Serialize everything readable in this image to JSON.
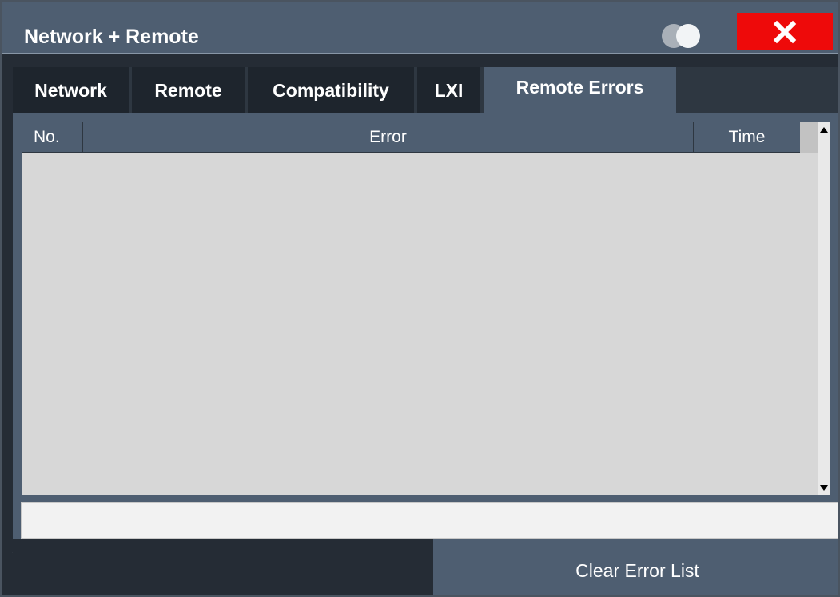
{
  "window": {
    "title": "Network + Remote",
    "toggle_icon": "toggle-icon",
    "close_icon": "close-icon",
    "close_color": "#ee0a0a"
  },
  "tabs": [
    {
      "label": "Network",
      "active": false
    },
    {
      "label": "Remote",
      "active": false
    },
    {
      "label": "Compatibility",
      "active": false
    },
    {
      "label": "LXI",
      "active": false
    },
    {
      "label": "Remote Errors",
      "active": true
    }
  ],
  "error_table": {
    "columns": [
      "No.",
      "Error",
      "Time"
    ],
    "rows": []
  },
  "status_field": {
    "value": ""
  },
  "actions": {
    "clear_label": "Clear Error List"
  },
  "colors": {
    "accent": "#4e5e71",
    "table_background": "#d7d7d7"
  }
}
